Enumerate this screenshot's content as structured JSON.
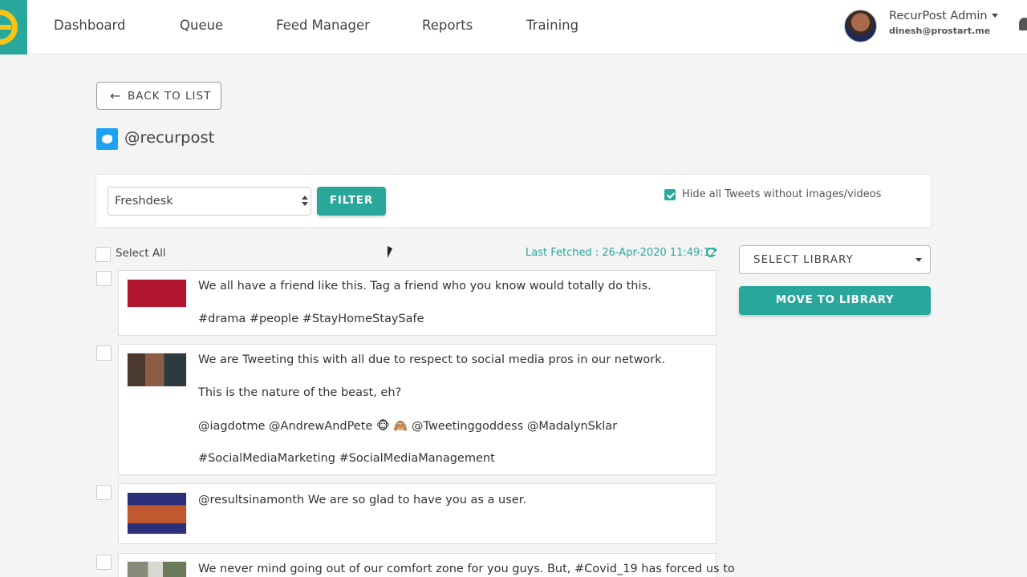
{
  "nav": {
    "items": [
      "Dashboard",
      "Queue",
      "Feed Manager",
      "Reports",
      "Training"
    ],
    "user_name": "RecurPost Admin",
    "user_email": "dinesh@prostart.me"
  },
  "page": {
    "back_label": "BACK TO LIST",
    "handle": "@recurpost"
  },
  "filter": {
    "selected": "Freshdesk",
    "button_label": "FILTER",
    "hide_label": "Hide all Tweets without images/videos",
    "hide_checked": true
  },
  "list": {
    "select_all_label": "Select All",
    "last_fetched": "Last Fetched : 26-Apr-2020 11:49:12"
  },
  "tweets": [
    {
      "lines": [
        "We all have a friend like this. Tag a friend who you know would totally do this.",
        "#drama #people #StayHomeStaySafe"
      ]
    },
    {
      "lines": [
        "We are Tweeting this with all due to respect to social media pros in our network.",
        "This is the nature of the beast, eh?",
        "@iagdotme @AndrewAndPete 🐵 🙈 @Tweetinggoddess @MadalynSklar",
        "#SocialMediaMarketing #SocialMediaManagement"
      ]
    },
    {
      "lines": [
        "@resultsinamonth We are so glad to have you as a user."
      ]
    },
    {
      "lines": [
        "We never mind going out of our comfort zone for you guys. But, #Covid_19 has forced us to"
      ]
    }
  ],
  "library": {
    "select_label": "SELECT LIBRARY",
    "move_label": "MOVE TO LIBRARY"
  },
  "colors": {
    "accent": "#2aa79b",
    "twitter": "#1da1f2",
    "logo_yellow": "#f5c518"
  }
}
